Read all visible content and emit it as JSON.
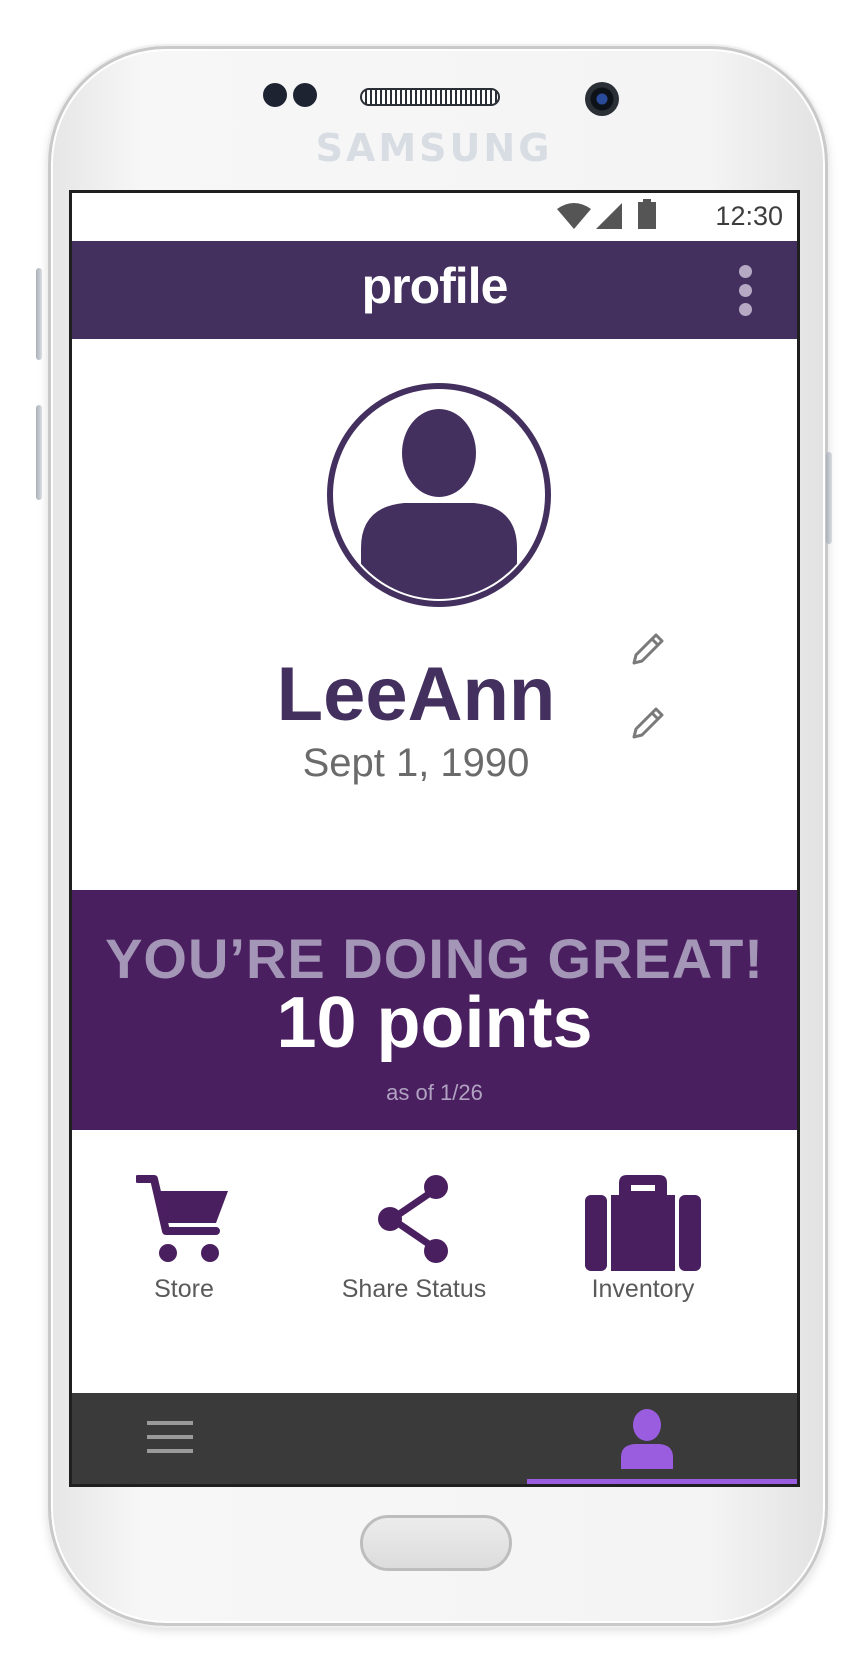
{
  "device": {
    "brand": "SAMSUNG"
  },
  "status_bar": {
    "time": "12:30",
    "icons": [
      "wifi-icon",
      "cell-signal-icon",
      "battery-icon"
    ]
  },
  "app_bar": {
    "title": "profile",
    "menu_icon": "more-vert-icon"
  },
  "profile": {
    "name": "LeeAnn",
    "birthdate": "Sept 1, 1990",
    "edit_icon": "pencil-icon"
  },
  "points_banner": {
    "headline": "YOU’RE DOING GREAT!",
    "points": "10 points",
    "as_of": "as of 1/26"
  },
  "actions": [
    {
      "label": "Store",
      "icon": "shopping-cart-icon"
    },
    {
      "label": "Share Status",
      "icon": "share-icon"
    },
    {
      "label": "Inventory",
      "icon": "suitcase-icon"
    }
  ],
  "bottom_nav": {
    "items": [
      {
        "icon": "hamburger-menu-icon",
        "active": false
      },
      {
        "icon": "person-icon",
        "active": true
      }
    ]
  },
  "colors": {
    "primary": "#44305f",
    "banner": "#4a1f60",
    "accent": "#9b5de0",
    "nav_background": "#3a3a3a"
  }
}
